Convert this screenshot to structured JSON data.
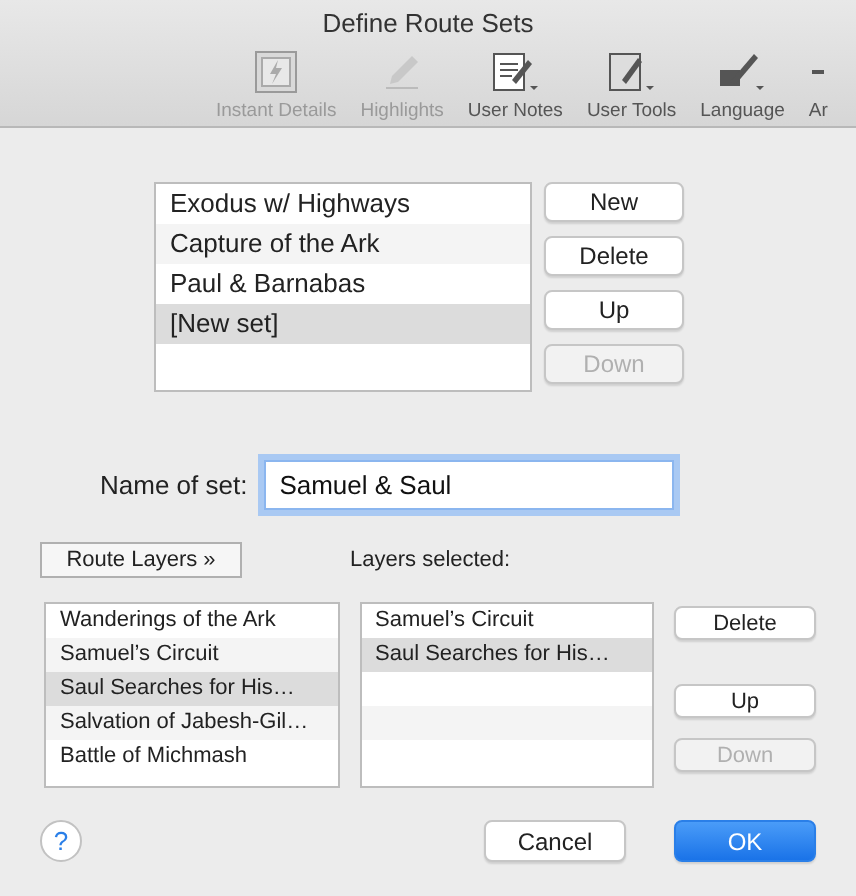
{
  "window": {
    "title": "Define Route Sets"
  },
  "toolbar": [
    {
      "label": "Instant Details",
      "kind": "details",
      "disabled": true
    },
    {
      "label": "Highlights",
      "kind": "highlight",
      "disabled": true
    },
    {
      "label": "User Notes",
      "kind": "notes",
      "disabled": false
    },
    {
      "label": "User Tools",
      "kind": "tools",
      "disabled": false
    },
    {
      "label": "Language",
      "kind": "language",
      "disabled": false
    },
    {
      "label": "Ar",
      "kind": "more",
      "disabled": false
    }
  ],
  "route_sets": [
    {
      "label": "Exodus w/ Highways",
      "selected": false
    },
    {
      "label": "Capture of the Ark",
      "selected": false
    },
    {
      "label": "Paul & Barnabas",
      "selected": false
    },
    {
      "label": "[New set]",
      "selected": true
    }
  ],
  "set_buttons": [
    {
      "label": "New",
      "disabled": false
    },
    {
      "label": "Delete",
      "disabled": false
    },
    {
      "label": "Up",
      "disabled": false
    },
    {
      "label": "Down",
      "disabled": true
    }
  ],
  "name_field": {
    "label": "Name of set:",
    "value": "Samuel & Saul"
  },
  "route_layers_button": "Route Layers »",
  "layers_selected_label": "Layers selected:",
  "available_layers": [
    {
      "label": "Wanderings of the Ark",
      "selected": false
    },
    {
      "label": "Samuel’s Circuit",
      "selected": false
    },
    {
      "label": "Saul Searches for His…",
      "selected": true
    },
    {
      "label": "Salvation of Jabesh-Gil…",
      "selected": false
    },
    {
      "label": "Battle of Michmash",
      "selected": false
    }
  ],
  "selected_layers": [
    {
      "label": "Samuel’s Circuit",
      "selected": false
    },
    {
      "label": "Saul Searches for His…",
      "selected": true
    }
  ],
  "layer_buttons": [
    {
      "label": "Delete",
      "disabled": false
    },
    {
      "label": "Up",
      "disabled": false
    },
    {
      "label": "Down",
      "disabled": true
    }
  ],
  "help": "?",
  "footer_buttons": [
    {
      "label": "Cancel",
      "kind": "default"
    },
    {
      "label": "OK",
      "kind": "primary"
    }
  ]
}
